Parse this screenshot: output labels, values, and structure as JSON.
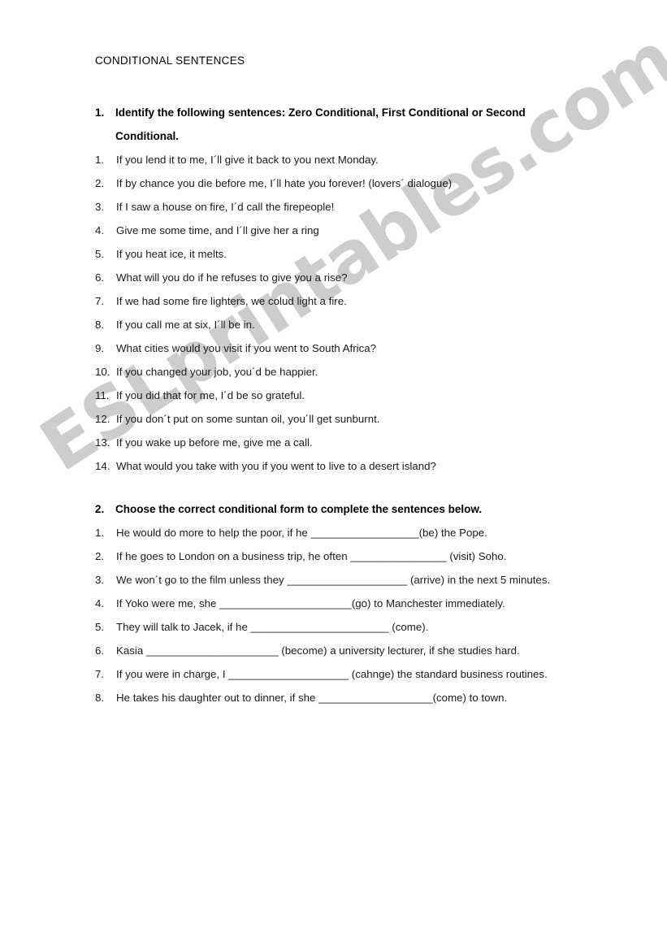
{
  "document": {
    "title": "CONDITIONAL SENTENCES",
    "watermark": "ESLprintables.com",
    "watermark_color": "#cdcdcd"
  },
  "sections": [
    {
      "number": "1.",
      "heading": "Identify the following sentences: Zero Conditional, First Conditional or Second Conditional.",
      "items": [
        {
          "number": "1.",
          "text": "If you lend it to me, I´ll give it back to you next Monday."
        },
        {
          "number": "2.",
          "text": "If by chance you die before me, I´ll hate you forever! (lovers´ dialogue)"
        },
        {
          "number": "3.",
          "text": "If I saw a house on fire, I´d call the firepeople!"
        },
        {
          "number": "4.",
          "text": "Give me some time, and I´ll give her a ring"
        },
        {
          "number": "5.",
          "text": "If you heat ice, it melts."
        },
        {
          "number": "6.",
          "text": "What will you do if he refuses to give you a rise?"
        },
        {
          "number": "7.",
          "text": "If we had some fire lighters, we colud light a fire."
        },
        {
          "number": "8.",
          "text": "If you call me at six, I´ll be in."
        },
        {
          "number": "9.",
          "text": "What cities would you visit if you went to South Africa?"
        },
        {
          "number": "10.",
          "text": "If you changed your job, you´d be happier."
        },
        {
          "number": "11.",
          "text": "If you did that for me, I´d be so grateful."
        },
        {
          "number": "12.",
          "text": "If you don´t put on some suntan oil, you´ll get sunburnt."
        },
        {
          "number": "13.",
          "text": "If you wake up before me, give me a call."
        },
        {
          "number": "14.",
          "text": "What would you take with you if you went to live to a desert island?"
        }
      ]
    },
    {
      "number": "2.",
      "heading": "Choose the correct conditional form to complete the sentences below.",
      "items": [
        {
          "number": "1.",
          "text": "He would do more to help the poor, if he __________________(be) the Pope."
        },
        {
          "number": "2.",
          "text": "If he goes to London on a business trip, he often ________________ (visit) Soho."
        },
        {
          "number": "3.",
          "text": "We won´t go to the film unless they ____________________ (arrive) in the next 5 minutes."
        },
        {
          "number": "4.",
          "text": "If Yoko were me, she ______________________(go) to Manchester immediately."
        },
        {
          "number": "5.",
          "text": "They will talk to Jacek, if he _______________________ (come)."
        },
        {
          "number": "6.",
          "text": "Kasia ______________________ (become) a university lecturer, if she studies hard."
        },
        {
          "number": "7.",
          "text": "If you were in charge, I ____________________ (cahnge) the standard business routines."
        },
        {
          "number": "8.",
          "text": "He takes his daughter out to dinner, if she ___________________(come) to town."
        }
      ]
    }
  ]
}
